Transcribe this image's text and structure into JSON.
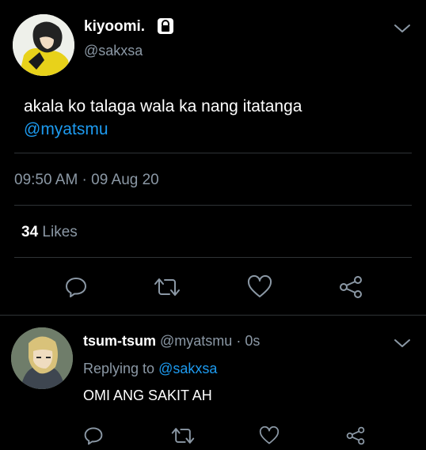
{
  "tweet": {
    "display_name": "kiyoomi.",
    "handle": "@sakxsa",
    "text": "akala ko talaga wala ka nang itatanga",
    "mention": "@myatsmu",
    "timestamp": "09:50 AM · 09 Aug 20",
    "likes_count": "34",
    "likes_label": "Likes"
  },
  "reply": {
    "display_name": "tsum-tsum",
    "handle": "@myatsmu",
    "time": "· 0s",
    "replying_to_label": "Replying to",
    "replying_to_handle": "@sakxsa",
    "text": "OMI ANG SAKIT AH"
  },
  "icons": {
    "lock": "lock-icon",
    "chevron": "chevron-down-icon",
    "reply": "reply-icon",
    "retweet": "retweet-icon",
    "like": "heart-icon",
    "share": "share-icon"
  },
  "colors": {
    "background": "#000000",
    "text": "#ffffff",
    "muted": "#8b98a5",
    "link": "#1d9bf0",
    "divider": "#2f3336"
  }
}
